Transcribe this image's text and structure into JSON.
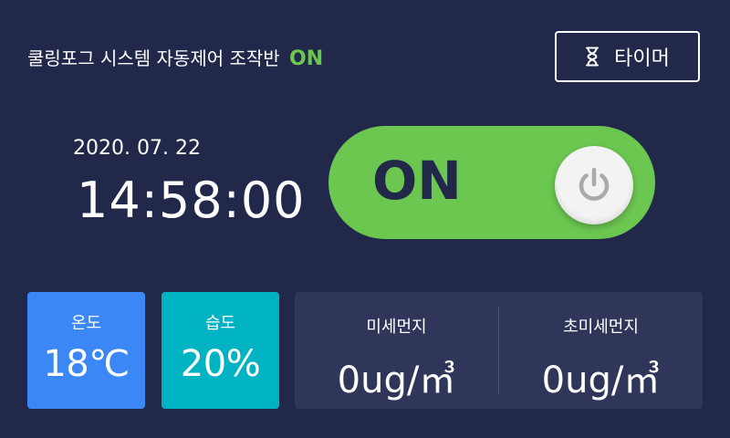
{
  "header": {
    "title": "쿨링포그 시스템 자동제어 조작반",
    "status": "ON",
    "status_color": "#6cc751"
  },
  "timer_button": {
    "label": "타이머",
    "icon": "hourglass-icon"
  },
  "clock": {
    "date": "2020. 07. 22",
    "time": "14:58:00"
  },
  "power_toggle": {
    "state_label": "ON",
    "on_color": "#6cc751",
    "icon": "power-icon"
  },
  "sensors": {
    "temperature": {
      "label": "온도",
      "value": "18℃",
      "color": "#3b87f5"
    },
    "humidity": {
      "label": "습도",
      "value": "20%",
      "color": "#00b3c3"
    },
    "fine_dust": {
      "label": "미세먼지",
      "value": "0ug/㎥"
    },
    "ultrafine_dust": {
      "label": "초미세먼지",
      "value": "0ug/㎥"
    }
  },
  "colors": {
    "background": "#22284a",
    "dust_panel": "#2f3659"
  }
}
